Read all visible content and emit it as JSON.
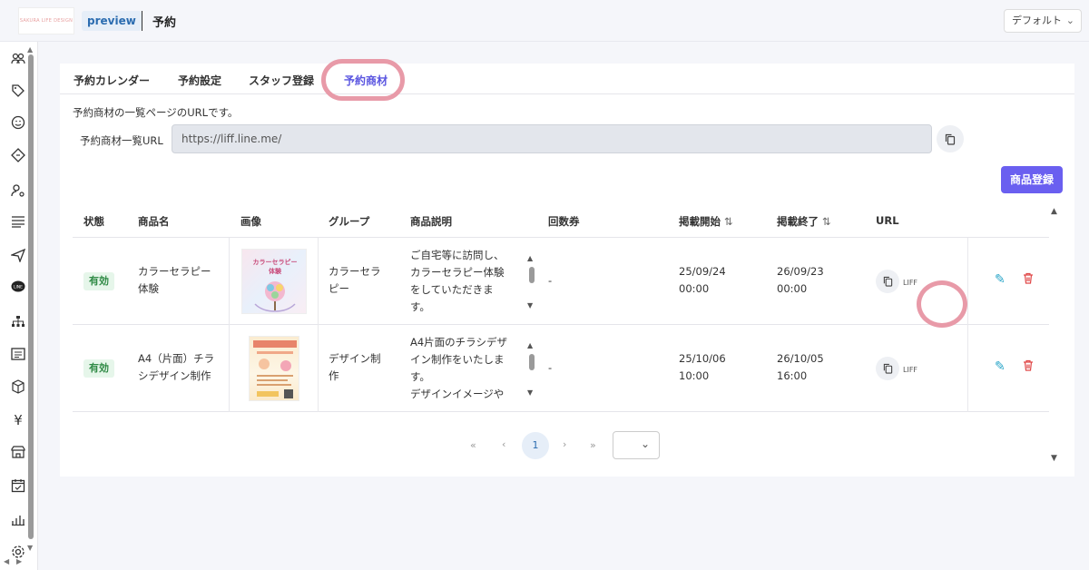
{
  "header": {
    "logo_text": "SAKURA LIFE DESIGN",
    "preview_badge": "preview",
    "title": "予約",
    "view_select": "デフォルト"
  },
  "sidebar": {
    "icons": [
      "users-icon",
      "tag-icon",
      "smile-icon",
      "ticket-icon",
      "user-settings-icon",
      "list-icon",
      "send-icon",
      "line-icon",
      "org-chart-icon",
      "document-icon",
      "box-icon",
      "yen-icon",
      "store-icon",
      "calendar-check-icon",
      "bar-chart-icon",
      "settings-icon"
    ]
  },
  "tabs": [
    {
      "label": "予約カレンダー",
      "active": false
    },
    {
      "label": "予約設定",
      "active": false
    },
    {
      "label": "スタッフ登録",
      "active": false
    },
    {
      "label": "予約商材",
      "active": true
    }
  ],
  "url_section": {
    "description": "予約商材の一覧ページのURLです。",
    "label": "予約商材一覧URL",
    "value": "https://liff.line.me/"
  },
  "register_button": "商品登録",
  "table": {
    "headers": {
      "status": "状態",
      "name": "商品名",
      "image": "画像",
      "group": "グループ",
      "description": "商品説明",
      "tickets": "回数券",
      "start": "掲載開始",
      "end": "掲載終了",
      "url": "URL"
    },
    "sort_glyph": "⇅",
    "liff_label": "LIFF",
    "rows": [
      {
        "status": "有効",
        "name_line1": "カラーセラピー",
        "name_line2": "体験",
        "image_alt": "カラーセラピー体験",
        "group_line1": "カラーセラ",
        "group_line2": "ピー",
        "desc_line1": "ご自宅等に訪問し、",
        "desc_line2": "カラーセラピー体験",
        "desc_line3": "をしていただきま",
        "desc_line4": "す。",
        "tickets": "-",
        "start_date": "25/09/24",
        "start_time": "00:00",
        "end_date": "26/09/23",
        "end_time": "00:00"
      },
      {
        "status": "有効",
        "name_line1": "A4（片面）チラ",
        "name_line2": "シデザイン制作",
        "image_alt": "チラシデザイン",
        "group_line1": "デザイン制",
        "group_line2": "作",
        "desc_line1": "A4片面のチラシデザ",
        "desc_line2": "イン制作をいたしま",
        "desc_line3": "す。",
        "desc_line4": "デザインイメージや",
        "tickets": "-",
        "start_date": "25/10/06",
        "start_time": "10:00",
        "end_date": "26/10/05",
        "end_time": "16:00"
      }
    ]
  },
  "pagination": {
    "first": "«",
    "prev": "‹",
    "current": "1",
    "next": "›",
    "last": "»",
    "page_size": ""
  },
  "colors": {
    "accent": "#6a5ff0",
    "highlight_ring": "#e89aa8",
    "active_badge_bg": "#e6f6ea",
    "active_badge_text": "#2f8a45",
    "edit": "#29a5c8",
    "delete": "#e04848"
  }
}
